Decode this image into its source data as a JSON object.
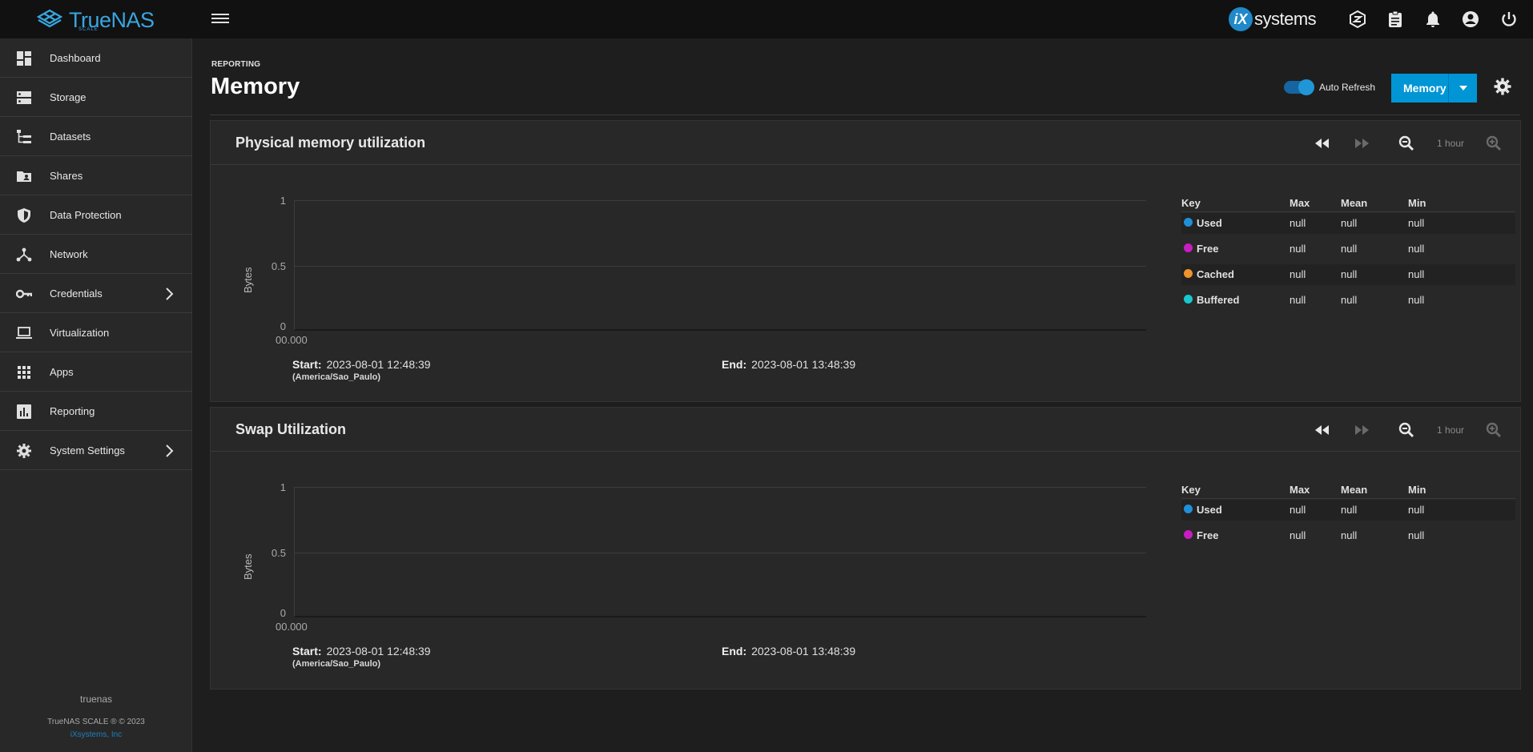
{
  "header": {
    "brand": "TrueNAS",
    "brand_sub": "SCALE",
    "vendor_badge": "iX",
    "vendor": "systems",
    "icons": [
      "truecommand-icon",
      "jobs-clipboard-icon",
      "notifications-bell-icon",
      "account-circle-icon",
      "power-icon"
    ]
  },
  "sidebar": {
    "items": [
      {
        "label": "Dashboard",
        "icon": "dashboard-icon"
      },
      {
        "label": "Storage",
        "icon": "storage-icon"
      },
      {
        "label": "Datasets",
        "icon": "datasets-icon"
      },
      {
        "label": "Shares",
        "icon": "shares-icon"
      },
      {
        "label": "Data Protection",
        "icon": "shield-icon"
      },
      {
        "label": "Network",
        "icon": "network-icon"
      },
      {
        "label": "Credentials",
        "icon": "key-icon"
      },
      {
        "label": "Virtualization",
        "icon": "laptop-icon"
      },
      {
        "label": "Apps",
        "icon": "apps-grid-icon"
      },
      {
        "label": "Reporting",
        "icon": "reporting-icon"
      },
      {
        "label": "System Settings",
        "icon": "gear-icon"
      }
    ],
    "hostname": "truenas",
    "copyright": "TrueNAS SCALE ® © 2023",
    "company": "iXsystems, Inc"
  },
  "page": {
    "breadcrumb": "REPORTING",
    "title": "Memory",
    "auto_refresh_label": "Auto Refresh",
    "auto_refresh_on": true,
    "report_select": "Memory"
  },
  "cards": [
    {
      "title": "Physical memory utilization",
      "zoom_label": "1 hour",
      "chart": {
        "ylabel": "Bytes",
        "yticks": [
          "1",
          "0.5",
          "0"
        ],
        "xtick": "00.000",
        "start_label": "Start:",
        "start": "2023-08-01 12:48:39",
        "timezone": "(America/Sao_Paulo)",
        "end_label": "End:",
        "end": "2023-08-01 13:48:39"
      },
      "legend": {
        "headers": [
          "Key",
          "Max",
          "Mean",
          "Min"
        ],
        "rows": [
          {
            "key": "Used",
            "color": "#1e90d8",
            "max": "null",
            "mean": "null",
            "min": "null"
          },
          {
            "key": "Free",
            "color": "#c81dc2",
            "max": "null",
            "mean": "null",
            "min": "null"
          },
          {
            "key": "Cached",
            "color": "#f0932b",
            "max": "null",
            "mean": "null",
            "min": "null"
          },
          {
            "key": "Buffered",
            "color": "#17c8d0",
            "max": "null",
            "mean": "null",
            "min": "null"
          }
        ]
      }
    },
    {
      "title": "Swap Utilization",
      "zoom_label": "1 hour",
      "chart": {
        "ylabel": "Bytes",
        "yticks": [
          "1",
          "0.5",
          "0"
        ],
        "xtick": "00.000",
        "start_label": "Start:",
        "start": "2023-08-01 12:48:39",
        "timezone": "(America/Sao_Paulo)",
        "end_label": "End:",
        "end": "2023-08-01 13:48:39"
      },
      "legend": {
        "headers": [
          "Key",
          "Max",
          "Mean",
          "Min"
        ],
        "rows": [
          {
            "key": "Used",
            "color": "#1e90d8",
            "max": "null",
            "mean": "null",
            "min": "null"
          },
          {
            "key": "Free",
            "color": "#c81dc2",
            "max": "null",
            "mean": "null",
            "min": "null"
          }
        ]
      }
    }
  ]
}
